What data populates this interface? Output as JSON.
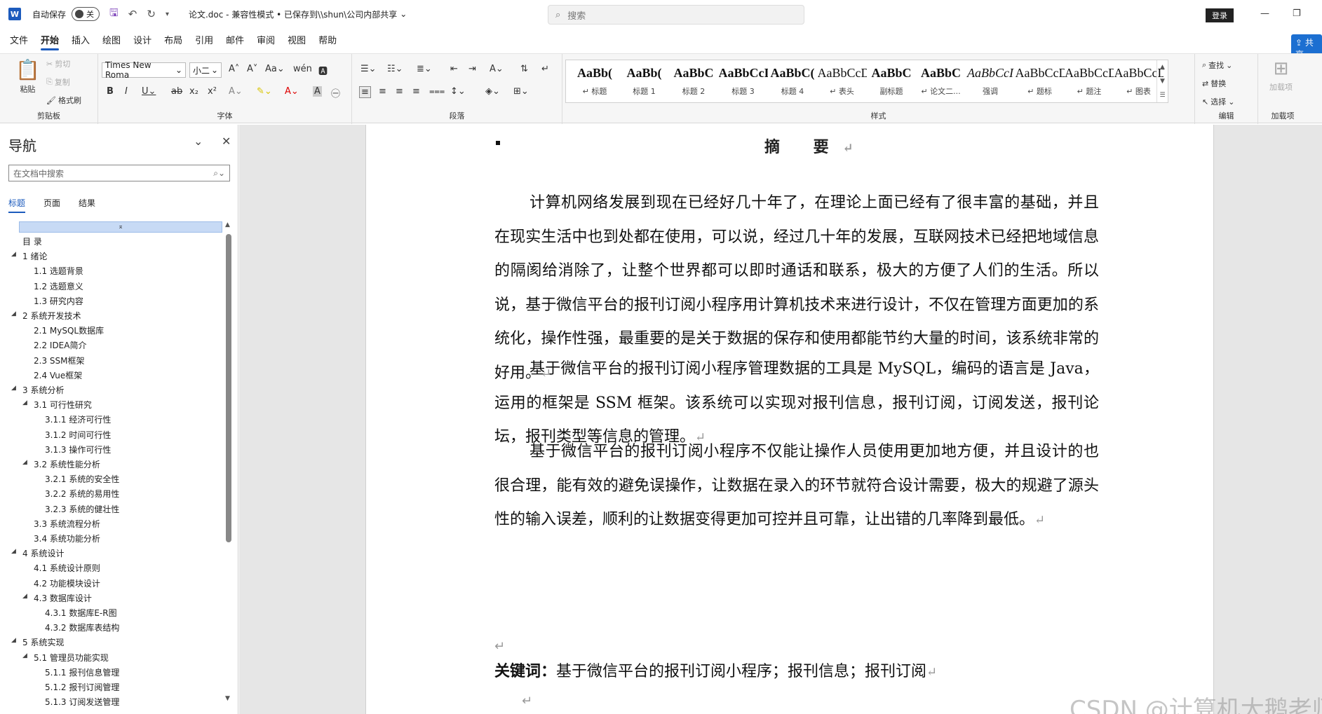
{
  "titlebar": {
    "autosave_label": "自动保存",
    "toggle_state": "关",
    "doc_title": "论文.doc  -  兼容性模式 • 已保存到\\\\shun\\公司内部共享",
    "search_placeholder": "搜索",
    "login": "登录"
  },
  "tabs": [
    "文件",
    "开始",
    "插入",
    "绘图",
    "设计",
    "布局",
    "引用",
    "邮件",
    "审阅",
    "视图",
    "帮助"
  ],
  "active_tab": "开始",
  "share_label": "共享",
  "ribbon": {
    "clipboard": {
      "paste": "粘贴",
      "cut": "剪切",
      "copy": "复制",
      "format_painter": "格式刷",
      "label": "剪贴板"
    },
    "font": {
      "name": "Times New Roma",
      "size": "小二",
      "label": "字体"
    },
    "paragraph": {
      "label": "段落"
    },
    "styles": {
      "label": "样式",
      "items": [
        {
          "sample": "AaBb(",
          "name": "↵ 标题"
        },
        {
          "sample": "AaBb(",
          "name": "标题 1"
        },
        {
          "sample": "AaBbC",
          "name": "标题 2"
        },
        {
          "sample": "AaBbCcI",
          "name": "标题 3"
        },
        {
          "sample": "AaBbC(",
          "name": "标题 4"
        },
        {
          "sample": "AaBbCcDc",
          "name": "↵ 表头"
        },
        {
          "sample": "AaBbC",
          "name": "副标题"
        },
        {
          "sample": "AaBbC",
          "name": "↵ 论文二..."
        },
        {
          "sample": "AaBbCcI",
          "name": "强调"
        },
        {
          "sample": "AaBbCcDc",
          "name": "↵ 题标"
        },
        {
          "sample": "AaBbCcDd",
          "name": "↵ 题注"
        },
        {
          "sample": "AaBbCcDc",
          "name": "↵ 图表"
        }
      ]
    },
    "editing": {
      "find": "查找",
      "replace": "替换",
      "select": "选择",
      "label": "编辑"
    },
    "addins": {
      "button": "加载项",
      "label": "加载项"
    }
  },
  "nav": {
    "title": "导航",
    "search_placeholder": "在文档中搜索",
    "tabs": [
      "标题",
      "页面",
      "结果"
    ],
    "active_tab": "标题",
    "outline": [
      {
        "text": "目  录",
        "level": 0,
        "arrow": ""
      },
      {
        "text": "1 绪论",
        "level": 0,
        "arrow": "◢"
      },
      {
        "text": "1.1 选题背景",
        "level": 1,
        "arrow": ""
      },
      {
        "text": "1.2 选题意义",
        "level": 1,
        "arrow": ""
      },
      {
        "text": "1.3 研究内容",
        "level": 1,
        "arrow": ""
      },
      {
        "text": "2 系统开发技术",
        "level": 0,
        "arrow": "◢"
      },
      {
        "text": "2.1 MySQL数据库",
        "level": 1,
        "arrow": ""
      },
      {
        "text": "2.2 IDEA简介",
        "level": 1,
        "arrow": ""
      },
      {
        "text": "2.3 SSM框架",
        "level": 1,
        "arrow": ""
      },
      {
        "text": "2.4 Vue框架",
        "level": 1,
        "arrow": ""
      },
      {
        "text": "3 系统分析",
        "level": 0,
        "arrow": "◢"
      },
      {
        "text": "3.1 可行性研究",
        "level": 1,
        "arrow": "◢"
      },
      {
        "text": "3.1.1 经济可行性",
        "level": 2,
        "arrow": ""
      },
      {
        "text": "3.1.2 时间可行性",
        "level": 2,
        "arrow": ""
      },
      {
        "text": "3.1.3 操作可行性",
        "level": 2,
        "arrow": ""
      },
      {
        "text": "3.2 系统性能分析",
        "level": 1,
        "arrow": "◢"
      },
      {
        "text": "3.2.1 系统的安全性",
        "level": 2,
        "arrow": ""
      },
      {
        "text": "3.2.2 系统的易用性",
        "level": 2,
        "arrow": ""
      },
      {
        "text": "3.2.3 系统的健壮性",
        "level": 2,
        "arrow": ""
      },
      {
        "text": "3.3 系统流程分析",
        "level": 1,
        "arrow": ""
      },
      {
        "text": "3.4 系统功能分析",
        "level": 1,
        "arrow": ""
      },
      {
        "text": "4 系统设计",
        "level": 0,
        "arrow": "◢"
      },
      {
        "text": "4.1 系统设计原则",
        "level": 1,
        "arrow": ""
      },
      {
        "text": "4.2 功能模块设计",
        "level": 1,
        "arrow": ""
      },
      {
        "text": "4.3 数据库设计",
        "level": 1,
        "arrow": "◢"
      },
      {
        "text": "4.3.1 数据库E-R图",
        "level": 2,
        "arrow": ""
      },
      {
        "text": "4.3.2 数据库表结构",
        "level": 2,
        "arrow": ""
      },
      {
        "text": "5 系统实现",
        "level": 0,
        "arrow": "◢"
      },
      {
        "text": "5.1 管理员功能实现",
        "level": 1,
        "arrow": "◢"
      },
      {
        "text": "5.1.1 报刊信息管理",
        "level": 2,
        "arrow": ""
      },
      {
        "text": "5.1.2 报刊订阅管理",
        "level": 2,
        "arrow": ""
      },
      {
        "text": "5.1.3 订阅发送管理",
        "level": 2,
        "arrow": ""
      }
    ]
  },
  "document": {
    "heading": "摘  要",
    "paragraphs": [
      "计算机网络发展到现在已经好几十年了，在理论上面已经有了很丰富的基础，并且在现实生活中也到处都在使用，可以说，经过几十年的发展，互联网技术已经把地域信息的隔阂给消除了，让整个世界都可以即时通话和联系，极大的方便了人们的生活。所以说，基于微信平台的报刊订阅小程序用计算机技术来进行设计，不仅在管理方面更加的系统化，操作性强，最重要的是关于数据的保存和使用都能节约大量的时间，该系统非常的好用。",
      "基于微信平台的报刊订阅小程序管理数据的工具是 MySQL，编码的语言是 Java，运用的框架是 SSM 框架。该系统可以实现对报刊信息，报刊订阅，订阅发送，报刊论坛，报刊类型等信息的管理。",
      "基于微信平台的报刊订阅小程序不仅能让操作人员使用更加地方便，并且设计的也很合理，能有效的避免误操作，让数据在录入的环节就符合设计需要，极大的规避了源头性的输入误差，顺利的让数据变得更加可控并且可靠，让出错的几率降到最低。"
    ],
    "keywords_label": "关键词：",
    "keywords": "基于微信平台的报刊订阅小程序；报刊信息；报刊订阅"
  },
  "watermark": "CSDN @计算机大鹅老师"
}
